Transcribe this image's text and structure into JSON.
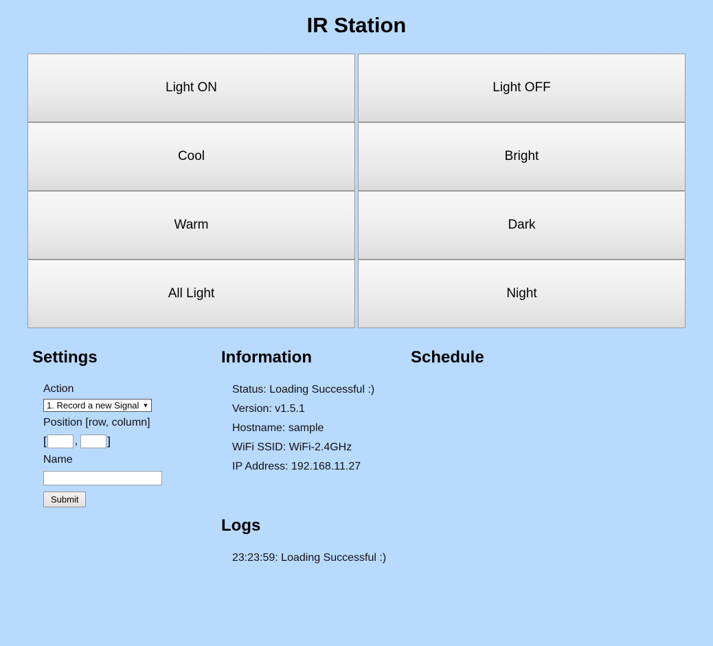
{
  "app": {
    "title": "IR Station",
    "background_color": "#b8daff"
  },
  "remote_buttons": [
    {
      "label": "Light ON"
    },
    {
      "label": "Light OFF"
    },
    {
      "label": "Cool"
    },
    {
      "label": "Bright"
    },
    {
      "label": "Warm"
    },
    {
      "label": "Dark"
    },
    {
      "label": "All Light"
    },
    {
      "label": "Night"
    }
  ],
  "settings": {
    "heading": "Settings",
    "action_label": "Action",
    "action_selected": "1. Record a new Signal",
    "action_caret": "▼",
    "position_label": "Position [row, column]",
    "bracket_open": "[",
    "bracket_close": "]",
    "comma": ",",
    "position_row_value": "",
    "position_row_placeholder": "",
    "position_column_value": "",
    "position_column_placeholder": "",
    "name_label": "Name",
    "name_value": "",
    "name_placeholder": "",
    "submit_label": "Submit"
  },
  "information": {
    "heading": "Information",
    "lines": [
      "Status: Loading Successful :)",
      "Version: v1.5.1",
      "Hostname: sample",
      "WiFi SSID: WiFi-2.4GHz",
      "IP Address: 192.168.11.27"
    ]
  },
  "schedule": {
    "heading": "Schedule",
    "entries": []
  },
  "logs": {
    "heading": "Logs",
    "entries": [
      "23:23:59: Loading Successful :)"
    ]
  }
}
